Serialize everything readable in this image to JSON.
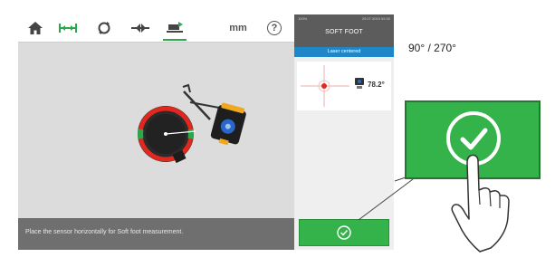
{
  "toolbar": {
    "items": [
      {
        "icon": "home-icon"
      },
      {
        "icon": "dimensions-icon"
      },
      {
        "icon": "measure-icon"
      },
      {
        "icon": "results-icon"
      },
      {
        "icon": "soft-foot-icon",
        "active": true
      },
      {
        "label": "mm"
      },
      {
        "icon": "help-icon",
        "label": "?"
      }
    ]
  },
  "status": {
    "message": "Place the sensor horizontally for Soft foot measurement."
  },
  "panel": {
    "status_left": "100%",
    "status_right": "29.07.2019 09:30",
    "title": "SOFT FOOT",
    "banner": "Laser centered",
    "angle": "78.2°"
  },
  "annotation": {
    "angle_range": "90° / 270°"
  },
  "colors": {
    "accent_green": "#33b34a",
    "banner_blue": "#1f86c8",
    "ring_red": "#e0281e"
  }
}
